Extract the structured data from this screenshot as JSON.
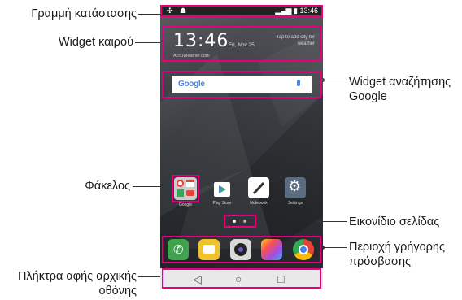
{
  "labels": {
    "status_bar": "Γραμμή κατάστασης",
    "weather_widget": "Widget καιρού",
    "folder": "Φάκελος",
    "touch_keys_line1": "Πλήκτρα αφής αρχικής",
    "touch_keys_line2": "οθόνης",
    "google_widget_line1": "Widget αναζήτησης",
    "google_widget_line2": "Google",
    "page_icon": "Εικονίδιο σελίδας",
    "quick_access_line1": "Περιοχή γρήγορης",
    "quick_access_line2": "πρόσβασης"
  },
  "phone": {
    "status_time": "13:46",
    "weather_time": "13:46",
    "weather_date": "Fri, Nov 25",
    "weather_tap": "Tap to add city for weather",
    "weather_source": "AccuWeather.com",
    "search_logo": "Google",
    "apps": [
      "Play Store",
      "Notebook",
      "Settings"
    ],
    "folder_label": "Google"
  },
  "colors": {
    "highlight": "#e6007e",
    "google_blue": "#4285F4",
    "google_red": "#EA4335",
    "google_yellow": "#FBBC05",
    "google_green": "#34A853"
  },
  "icons": {
    "phone_dock": "phone-icon",
    "messages_dock": "messages-icon",
    "camera_dock": "camera-icon",
    "gallery_dock": "gallery-icon",
    "chrome_dock": "chrome-icon",
    "back": "back-icon",
    "home": "home-icon",
    "recents": "recents-icon"
  }
}
